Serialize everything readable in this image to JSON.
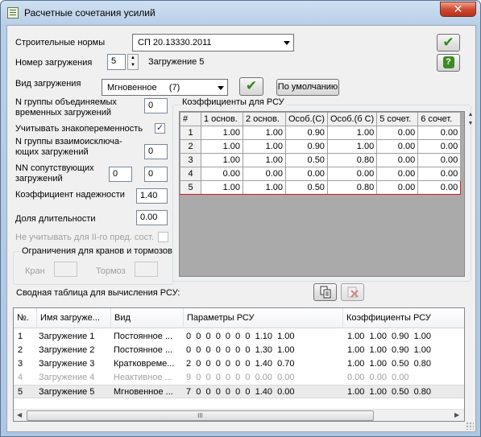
{
  "window": {
    "title": "Расчетные сочетания усилий",
    "close_label": "✕"
  },
  "form": {
    "norms_label": "Строительные нормы",
    "norms_value": "СП 20.13330.2011",
    "load_no_label": "Номер загружения",
    "load_no_value": "5",
    "load_name": "Загружение 5",
    "load_type_label": "Вид загружения",
    "load_type_value": "Мгновенное     (7)",
    "default_button": "По умолчанию",
    "combined_groups_label_1": "N группы объединяемых",
    "combined_groups_label_2": "временных загружений",
    "combined_groups_value": "0",
    "sign_var_label": "Учитывать знакопеременность",
    "sign_var_checked": "✓",
    "exclusive_groups_label_1": "N группы взаимоисключа-",
    "exclusive_groups_label_2": "ющих загружений",
    "exclusive_groups_value": "0",
    "accompanying_label_1": "NN сопутствующих",
    "accompanying_label_2": "загружений",
    "accompanying_value_1": "0",
    "accompanying_value_2": "0",
    "reliability_label": "Коэффициент надежности",
    "reliability_value": "1.40",
    "duration_label": "Доля длительности",
    "duration_value": "0.00",
    "ignore_label": "Не учитывать для II-го пред. сост.",
    "crane_group_label": "Ограничения для кранов и тормозов",
    "crane_label": "Кран",
    "brake_label": "Тормоз"
  },
  "coef_table": {
    "title": "Коэффициенты для РСУ",
    "headers": [
      "#",
      "1 основ.",
      "2 основ.",
      "Особ.(С)",
      "Особ.(б С)",
      "5 сочет.",
      "6 сочет."
    ],
    "rows": [
      [
        "1",
        "1.00",
        "1.00",
        "0.90",
        "1.00",
        "0.00",
        "0.00"
      ],
      [
        "2",
        "1.00",
        "1.00",
        "0.90",
        "1.00",
        "0.00",
        "0.00"
      ],
      [
        "3",
        "1.00",
        "1.00",
        "0.50",
        "0.80",
        "0.00",
        "0.00"
      ],
      [
        "4",
        "0.00",
        "0.00",
        "0.00",
        "0.00",
        "0.00",
        "0.00"
      ],
      [
        "5",
        "1.00",
        "1.00",
        "0.50",
        "0.80",
        "0.00",
        "0.00"
      ]
    ],
    "selected_row": "5"
  },
  "summary": {
    "title": "Сводная таблица для вычисления РСУ:",
    "headers": [
      "№.",
      "Имя загруже...",
      "Вид",
      "Параметры РСУ",
      "Коэффициенты РСУ"
    ],
    "rows": [
      [
        "1",
        "Загружение 1",
        "Постоянное ...",
        "0  0  0  0  0  0  0  1.10  1.00",
        "1.00  1.00  0.90  1.00"
      ],
      [
        "2",
        "Загружение 2",
        "Постоянное ...",
        "0  0  0  0  0  0  0  1.30  1.00",
        "1.00  1.00  0.90  1.00"
      ],
      [
        "3",
        "Загружение 3",
        "Кратковреме...",
        "2  0  0  0  0  0  0  1.40  0.70",
        "1.00  1.00  0.50  0.80"
      ],
      [
        "4",
        "Загружение 4",
        "Неактивное ...",
        "9  0  0  0  0  0  0  0.00  0.00",
        "0.00  0.00  0.00"
      ],
      [
        "5",
        "Загружение 5",
        "Мгновенное ...",
        "7  0  0  0  0  0  0  1.40  0.00",
        "1.00  1.00  0.50  0.80"
      ]
    ],
    "scroll_grip": "III"
  },
  "colors": {
    "title_bar": "#b8cfe8",
    "selection_border": "#d21a1a",
    "ok_green": "#2e8a1c"
  },
  "icons": {
    "ok": "check-icon",
    "help": "question-icon",
    "apply": "check-icon",
    "copy": "copy-icon",
    "delete": "delete-icon"
  }
}
